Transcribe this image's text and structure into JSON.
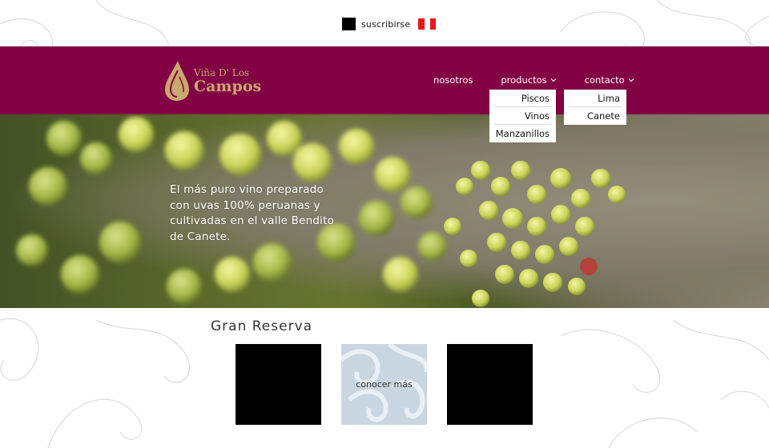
{
  "topbar": {
    "subscribe_label": "suscribirse",
    "flag_icon": "peru-flag-icon"
  },
  "brand": {
    "name_small": "Viña D' Los",
    "name_big": "Campos",
    "color": "#c8a96e"
  },
  "nav": {
    "items": [
      {
        "label": "nosotros"
      },
      {
        "label": "productos"
      },
      {
        "label": "contacto"
      }
    ],
    "products_menu": [
      "Piscos",
      "Vinos",
      "Manzanillos"
    ],
    "contact_menu": [
      "Lima",
      "Canete"
    ]
  },
  "hero": {
    "text": "El más puro vino preparado con uvas 100% peruanas y cultivadas en el valle Bendito de Canete."
  },
  "section": {
    "title": "Gran Reserva",
    "cards": [
      {
        "label": ""
      },
      {
        "label": "conocer más"
      },
      {
        "label": ""
      }
    ]
  },
  "colors": {
    "header": "#820044",
    "accent": "#c8a96e",
    "flag_red": "#e8161b"
  }
}
